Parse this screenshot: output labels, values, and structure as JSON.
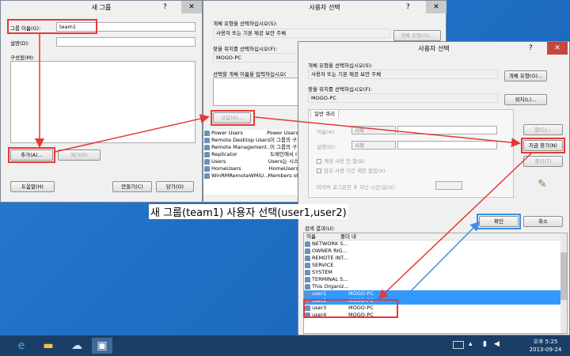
{
  "win1": {
    "title": "새 그룹",
    "help": "?",
    "close": "✕",
    "name_label": "그룹 이름(G):",
    "name_value": "team1",
    "desc_label": "설명(D):",
    "members_label": "구성원(M):",
    "add": "추가(A)...",
    "remove": "제거(R)",
    "help_btn": "도움말(H)",
    "create": "만들기(C)",
    "close_btn": "닫기(O)"
  },
  "win2": {
    "title": "사용자 선택",
    "help": "?",
    "close": "✕",
    "type_label": "개체 유형을 선택하십시오(S):",
    "type_value": "사용자 또는 기본 제공 보안 주체",
    "type_btn": "개체 유형(O)...",
    "loc_label": "찾을 위치를 선택하십시오(F):",
    "loc_value": "MOGO-PC",
    "names_label": "선택할 개체 이름을 입력하십시오(",
    "advanced": "고급(A)...",
    "rows": [
      [
        "Power Users",
        "Power Users"
      ],
      [
        "Remote Desktop Users",
        "이 그룹의 구"
      ],
      [
        "Remote Management...",
        "이 그룹의 구"
      ],
      [
        "Replicator",
        "도메인에서 I"
      ],
      [
        "Users",
        "Users는 시스"
      ],
      [
        "HomeUsers",
        "HomeUsers"
      ],
      [
        "WinRMRemoteWMIU...",
        "Members of"
      ]
    ]
  },
  "win3": {
    "title": "사용자 선택",
    "help": "?",
    "close": "✕",
    "type_label": "개체 유형을 선택하십시오(S):",
    "type_value": "사용자 또는 기본 제공 보안 주체",
    "type_btn": "개체 유형(O)...",
    "loc_label": "찾을 위치를 선택하십시오(F):",
    "loc_value": "MOGO-PC",
    "loc_btn": "위치(L)...",
    "query_label": "일반 쿼리",
    "tab": "일반 쿼리",
    "name_label": "이름(A):",
    "name_mode": "시작",
    "desc_label": "설명(D):",
    "desc_mode": "시작",
    "disabled_chk": "계정 사용 안 함(B)",
    "noexp_chk": "암호 사용 기간 제한 없음(X)",
    "lastlogon": "마지막 로그온한 후 지난 시간(일)(I):",
    "columns": "열(C)...",
    "find_now": "지금 찾기(N)",
    "stop": "중지(T)",
    "ok": "확인",
    "cancel": "취소",
    "results_label": "검색 결과(U):",
    "col_name": "이름",
    "col_folder": "폴더 내",
    "results": [
      [
        "NETWORK S...",
        ""
      ],
      [
        "OWNER RIG...",
        ""
      ],
      [
        "REMOTE INT...",
        ""
      ],
      [
        "SERVICE",
        ""
      ],
      [
        "SYSTEM",
        ""
      ],
      [
        "TERMINAL S...",
        ""
      ],
      [
        "This Organiz...",
        ""
      ],
      [
        "user1",
        "MOGO-PC"
      ],
      [
        "user2",
        "MOGO-PC"
      ],
      [
        "user3",
        "MOGO-PC"
      ],
      [
        "user4",
        "MOGO-PC"
      ]
    ]
  },
  "caption": "새 그룹(team1) 사용자 선택(user1,user2)",
  "taskbar": {
    "time": "오후 5:25",
    "date": "2013-09-24"
  },
  "colors": {
    "highlight": "#e53935",
    "blue": "#3a8ee6",
    "selected_row": "#3399ff"
  }
}
